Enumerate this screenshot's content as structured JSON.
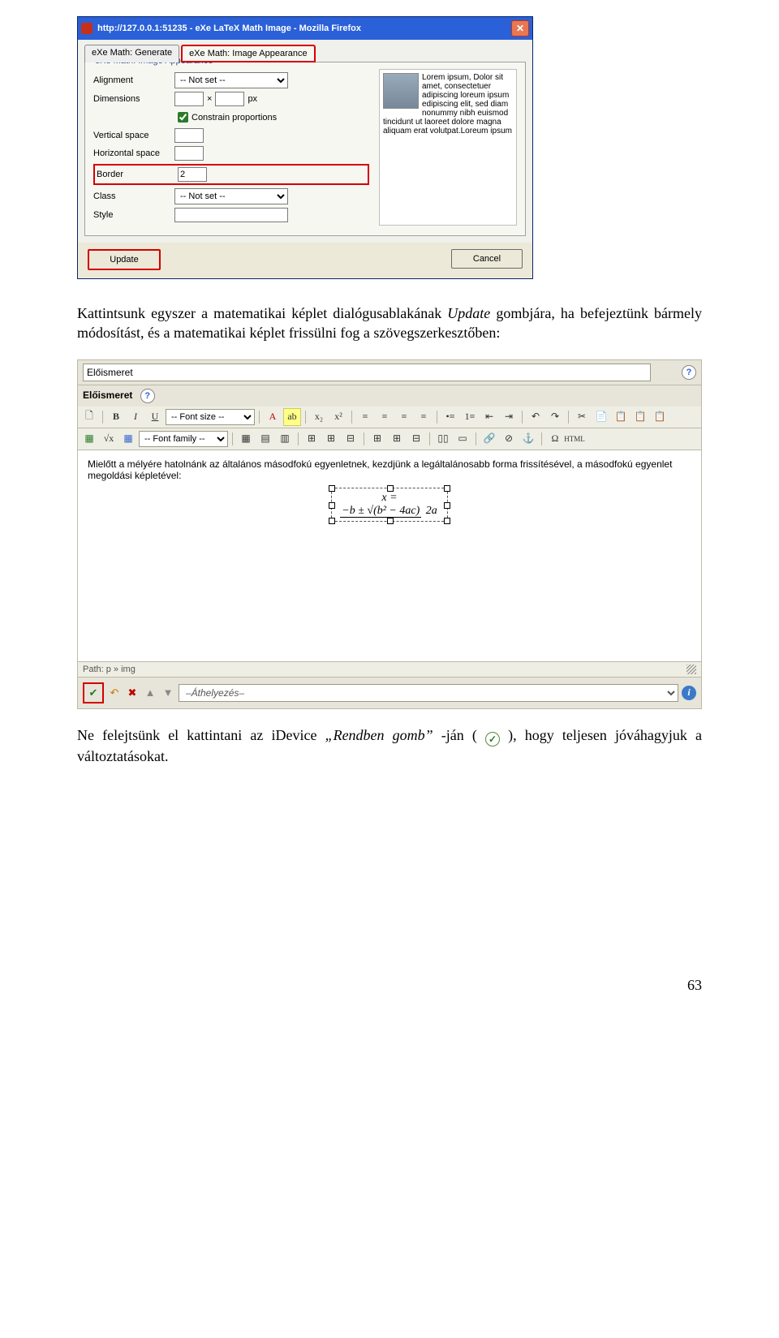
{
  "dialog": {
    "title": "http://127.0.0.1:51235 - eXe LaTeX Math Image - Mozilla Firefox",
    "close_glyph": "✕",
    "tabs": {
      "generate": "eXe Math: Generate",
      "appearance": "eXe Math: Image Appearance"
    },
    "legend": "eXe Math: Image Appearance",
    "labels": {
      "alignment": "Alignment",
      "dimensions": "Dimensions",
      "constrain": "Constrain proportions",
      "vspace": "Vertical space",
      "hspace": "Horizontal space",
      "border": "Border",
      "class": "Class",
      "style": "Style",
      "times": "×",
      "px": "px"
    },
    "values": {
      "alignment": "-- Not set --",
      "class": "-- Not set --",
      "border": "2",
      "dim_w": "",
      "dim_h": "",
      "vspace": "",
      "hspace": "",
      "style": ""
    },
    "preview_text": "Lorem ipsum, Dolor sit amet, consectetuer adipiscing loreum ipsum edipiscing elit, sed diam nonummy nibh euismod tincidunt ut laoreet dolore magna aliquam erat volutpat.Loreum ipsum",
    "buttons": {
      "update": "Update",
      "cancel": "Cancel"
    }
  },
  "para1": {
    "a": "Kattintsunk egyszer a matematikai képlet dialógusablakának ",
    "b": "Update",
    "c": " gombjára, ha befejeztünk bármely módosítást, és a matematikai képlet frissülni fog a szövegszerkesztőben:"
  },
  "editor": {
    "title_value": "Előismeret",
    "section_label": "Előismeret",
    "font_size_label": "-- Font size --",
    "font_family_label": "-- Font family --",
    "html_label": "HTML",
    "content": "Mielőtt a mélyére hatolnánk az általános másodfokú egyenletnek, kezdjünk a legáltalánosabb forma frissítésével, a másodfokú egyenlet megoldási képletével:",
    "formula": {
      "lhs": "x =",
      "num": "−b ± √(b² − 4ac)",
      "den": "2a"
    },
    "path": "Path: p » img",
    "move_label": "–Áthelyezés–"
  },
  "para2": {
    "a": "Ne felejtsünk el kattintani az iDevice ",
    "b": "„Rendben gomb”",
    "c": "-ján (",
    "d": "), hogy teljesen jóváhagyjuk a változtatásokat."
  },
  "check_glyph": "✓",
  "page_number": "63"
}
